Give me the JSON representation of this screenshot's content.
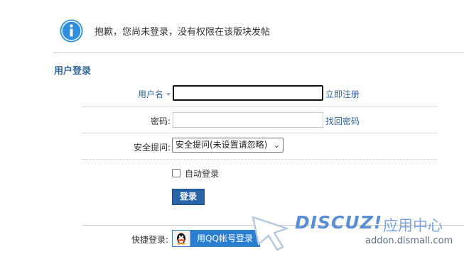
{
  "notice": {
    "icon": "info-icon",
    "message": "抱歉，您尚未登录，没有权限在该版块发帖"
  },
  "login": {
    "section_title": "用户登录",
    "username_label": "用户名",
    "username_value": "",
    "register_link": "立即注册",
    "password_label": "密码:",
    "password_value": "",
    "forgot_link": "找回密码",
    "security_label": "安全提问:",
    "security_selected": "安全提问(未设置请忽略)",
    "remember_label": "自动登录",
    "remember_checked": false,
    "login_button": "登录",
    "quick_label": "快捷登录:",
    "qq_button": "用QQ帐号登录"
  },
  "watermark": {
    "brand": "DISCUZ!",
    "cn": "应用中心",
    "url": "addon.dismall.com"
  },
  "colors": {
    "accent": "#336699",
    "button": "#2866a9",
    "qq": "#2a7ed1",
    "info_icon": "#2f8fdc"
  }
}
